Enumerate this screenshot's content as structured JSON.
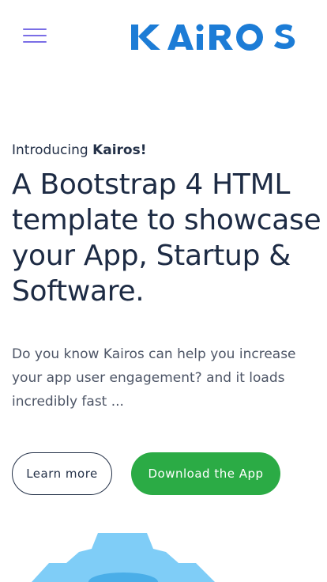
{
  "header": {
    "menu_icon": "hamburger-menu-icon",
    "brand_logo_text": "KAiROS",
    "brand_color": "#1c7cd6"
  },
  "hero": {
    "intro_prefix": "Introducing ",
    "intro_brand": "Kairos!",
    "headline": "A Bootstrap 4 HTML template to showcase your App, Startup & Software.",
    "lead": "Do you know Kairos can help you increase your app user engagement? and it loads incredibly fast ...",
    "learn_more_label": "Learn more",
    "download_label": "Download the App"
  },
  "colors": {
    "accent_green": "#2bab45",
    "text_dark": "#1d2b44",
    "menu_purple": "#7a6ee6",
    "gear_light_blue": "#7fcdf7"
  },
  "illustration": {
    "icon": "gear-icon"
  }
}
